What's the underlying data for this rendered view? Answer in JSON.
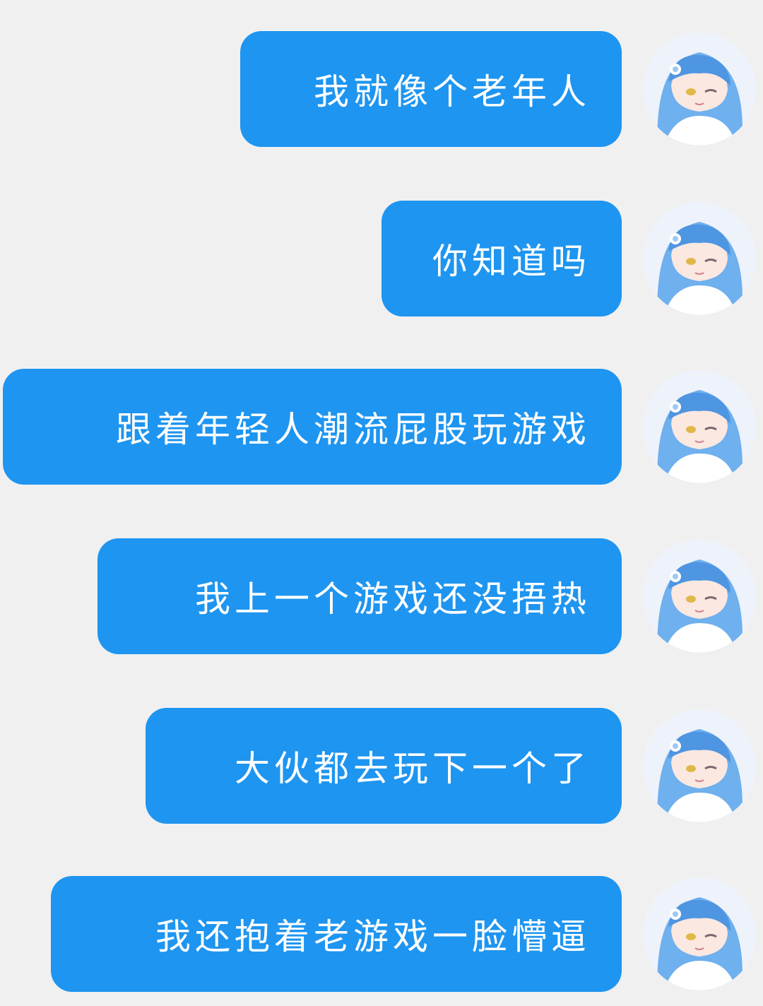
{
  "messages": [
    {
      "text": "我就像个老年人",
      "avatar_icon": "anime-girl-avatar"
    },
    {
      "text": "你知道吗",
      "avatar_icon": "anime-girl-avatar"
    },
    {
      "text": "跟着年轻人潮流屁股玩游戏",
      "avatar_icon": "anime-girl-avatar"
    },
    {
      "text": "我上一个游戏还没捂热",
      "avatar_icon": "anime-girl-avatar"
    },
    {
      "text": "大伙都去玩下一个了",
      "avatar_icon": "anime-girl-avatar"
    },
    {
      "text": "我还抱着老游戏一脸懵逼",
      "avatar_icon": "anime-girl-avatar"
    }
  ],
  "colors": {
    "background": "#f0f0f0",
    "bubble": "#1e95f0",
    "bubble_text": "#ffffff",
    "hair": "#6fb0ee",
    "hair_dark": "#3e7fd0"
  }
}
